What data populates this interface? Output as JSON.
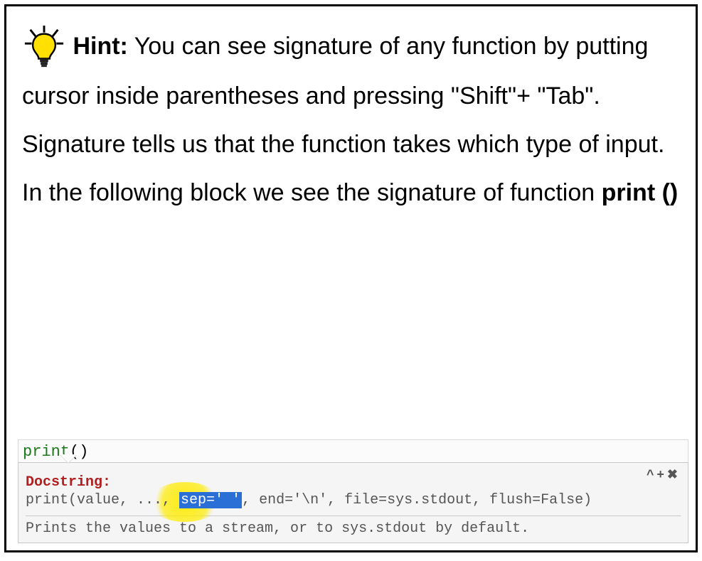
{
  "hint": {
    "label": "Hint:",
    "body": " You can see signature of any function by putting cursor inside parentheses and pressing \"Shift\"+ \"Tab\". Signature tells us that the function takes which type of input. In the following block we see the signature of function ",
    "func": "print ()"
  },
  "code": {
    "fn": "print",
    "parens": "()"
  },
  "tooltip": {
    "controls": {
      "caret": "^",
      "plus": "+",
      "close": "✖"
    },
    "docstring_label": "Docstring:",
    "signature": {
      "pre": "print(value, ..., ",
      "selected": "sep=' '",
      "post": ", end='\\n', file=sys.stdout, flush=False)"
    },
    "description": "Prints the values to a stream, or to sys.stdout by default."
  }
}
